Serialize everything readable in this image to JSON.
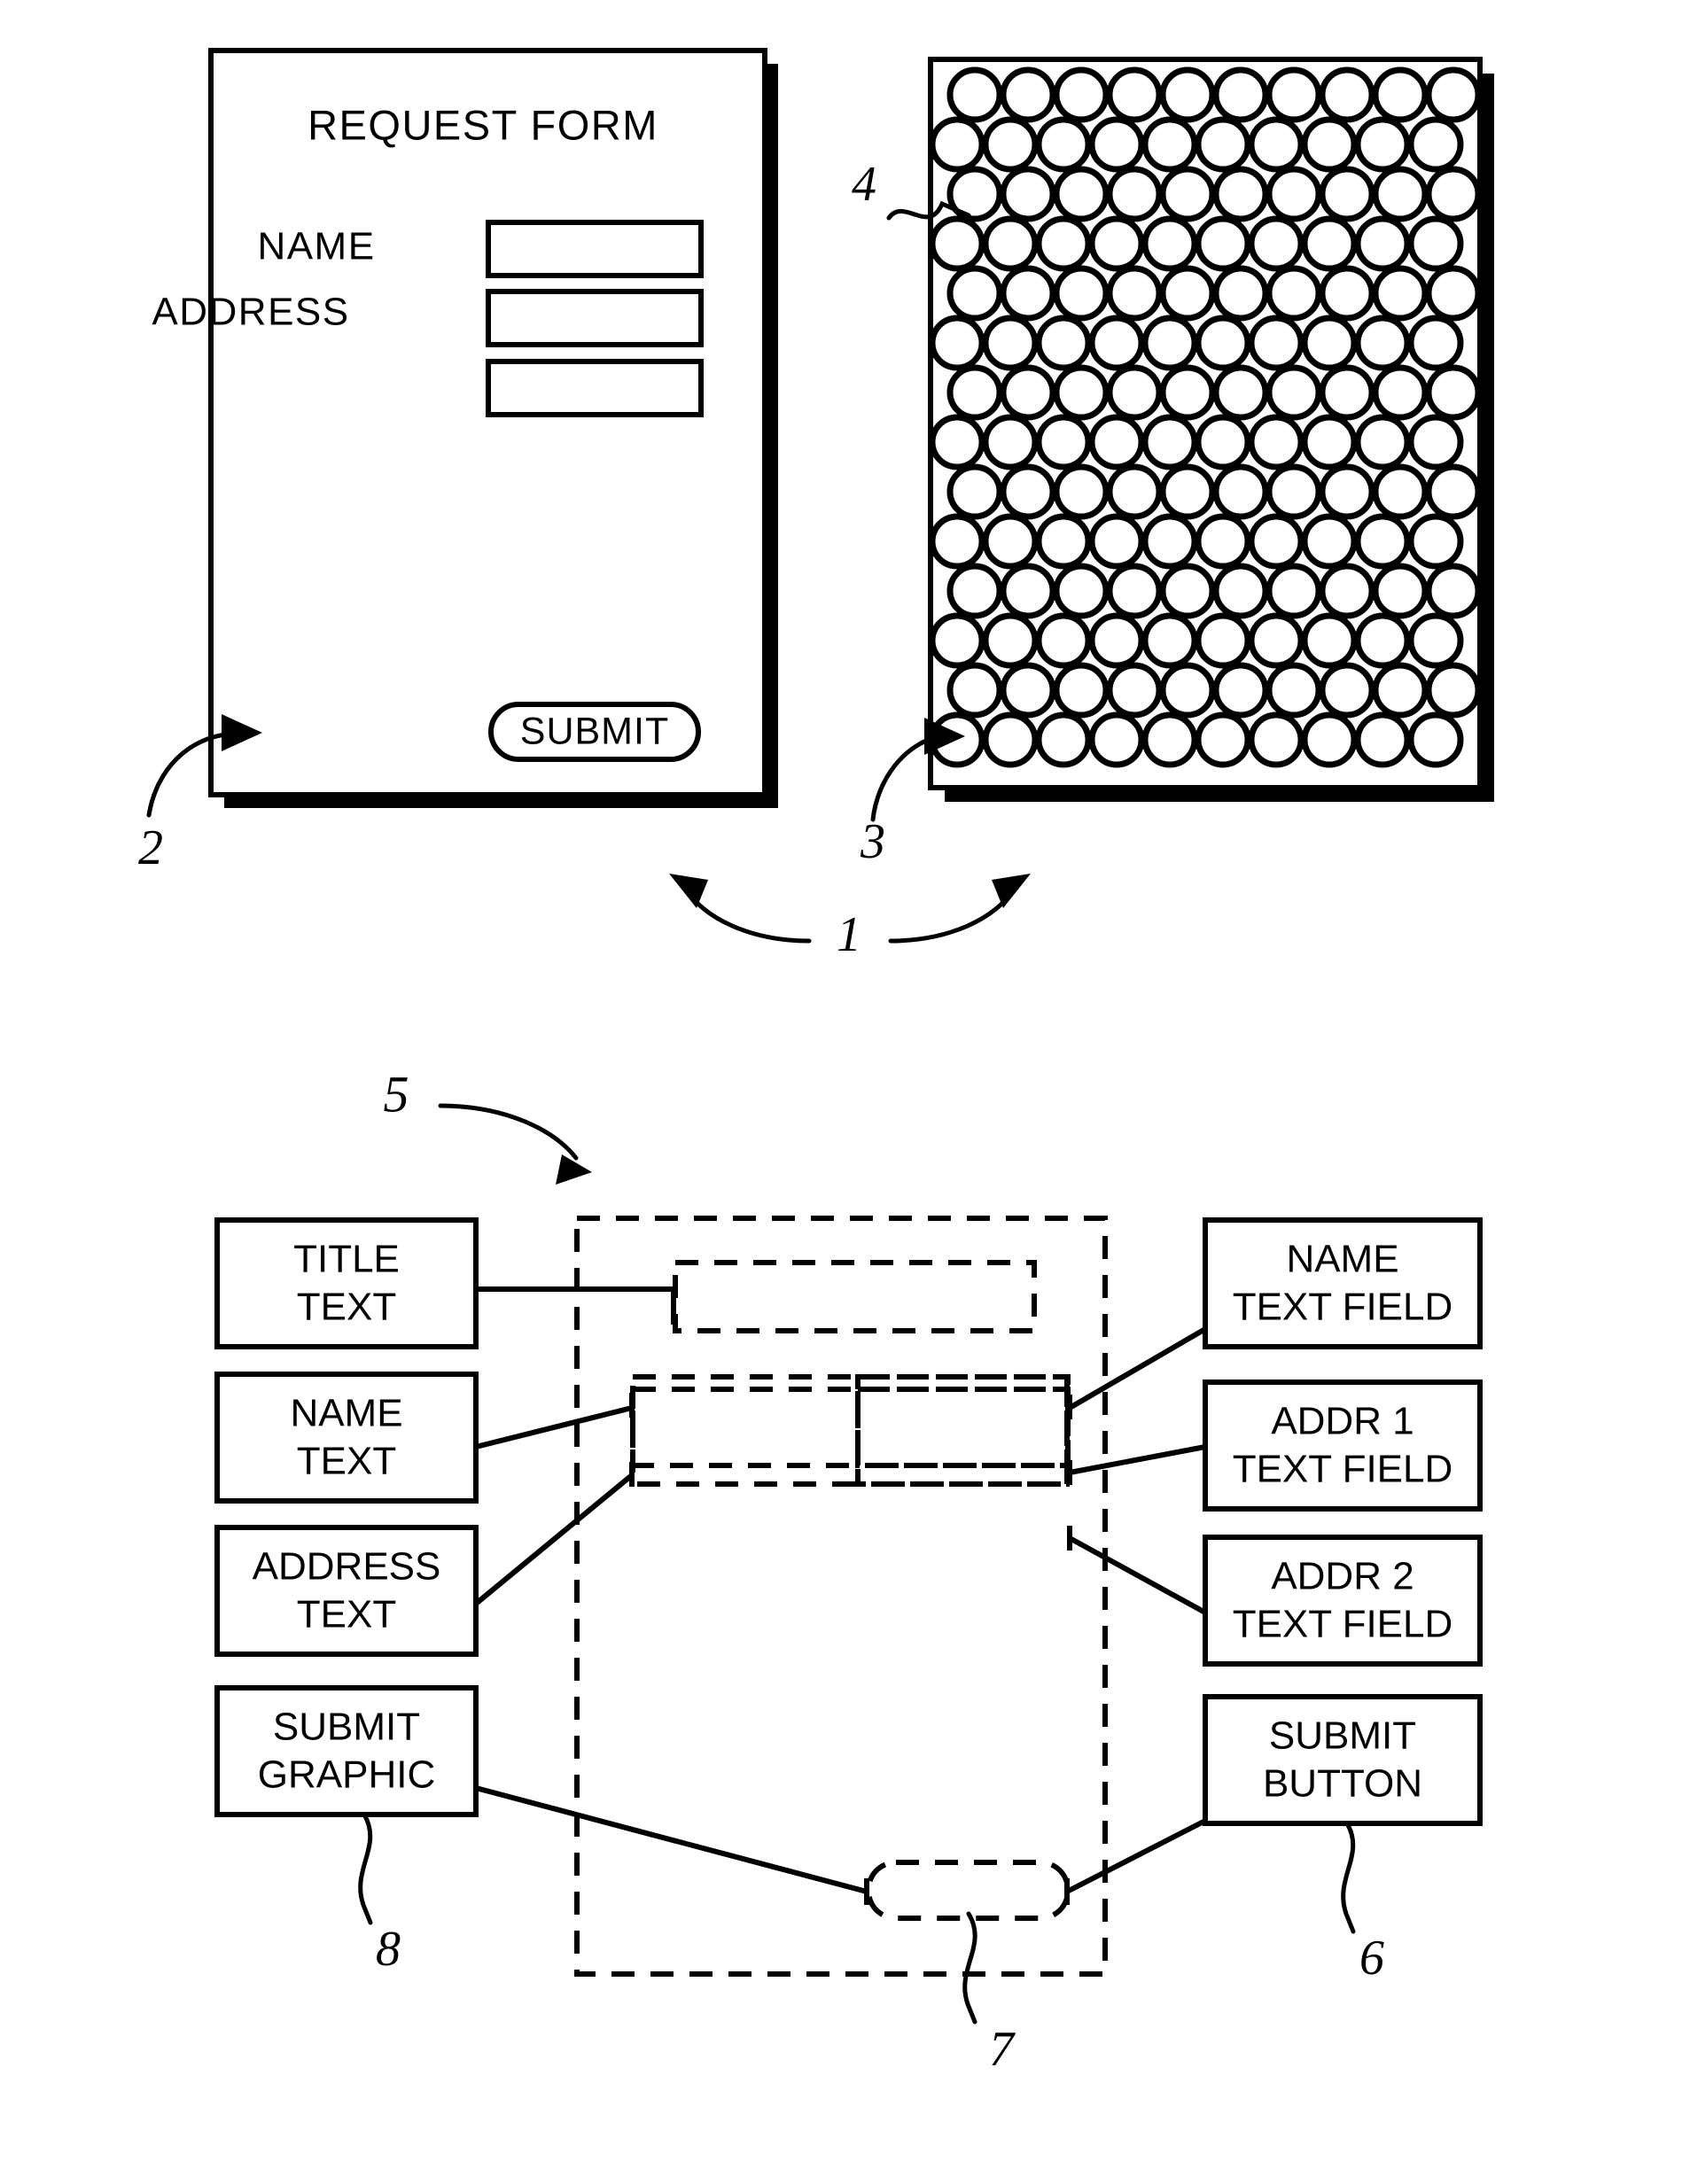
{
  "figure": {
    "title_hidden": "Patent figure: form document, halftone scan, and object-model diagram"
  },
  "request_form": {
    "title": "REQUEST FORM",
    "labels": {
      "name": "NAME",
      "address": "ADDRESS"
    },
    "fields": [
      {
        "name": "name-field",
        "value": ""
      },
      {
        "name": "address-line-1-field",
        "value": ""
      },
      {
        "name": "address-line-2-field",
        "value": ""
      }
    ],
    "submit_button_label": "SUBMIT"
  },
  "halftone_panel": {
    "description": "bitmap / halftone dot image",
    "dot_rows": 14,
    "dots_per_row": 10
  },
  "reference_numerals": {
    "n1": "1",
    "n2": "2",
    "n3": "3",
    "n4": "4",
    "n5": "5",
    "n6": "6",
    "n7": "7",
    "n8": "8"
  },
  "object_model": {
    "left_column": [
      {
        "id": "title-text",
        "line1": "TITLE",
        "line2": "TEXT"
      },
      {
        "id": "name-text",
        "line1": "NAME",
        "line2": "TEXT"
      },
      {
        "id": "address-text",
        "line1": "ADDRESS",
        "line2": "TEXT"
      },
      {
        "id": "submit-graphic",
        "line1": "SUBMIT",
        "line2": "GRAPHIC"
      }
    ],
    "right_column": [
      {
        "id": "name-text-field",
        "line1": "NAME",
        "line2": "TEXT FIELD"
      },
      {
        "id": "addr-1-text-field",
        "line1": "ADDR 1",
        "line2": "TEXT FIELD"
      },
      {
        "id": "addr-2-text-field",
        "line1": "ADDR 2",
        "line2": "TEXT FIELD"
      },
      {
        "id": "submit-button",
        "line1": "SUBMIT",
        "line2": "BUTTON"
      }
    ]
  },
  "colors": {
    "ink": "#000000",
    "paper": "#ffffff"
  }
}
